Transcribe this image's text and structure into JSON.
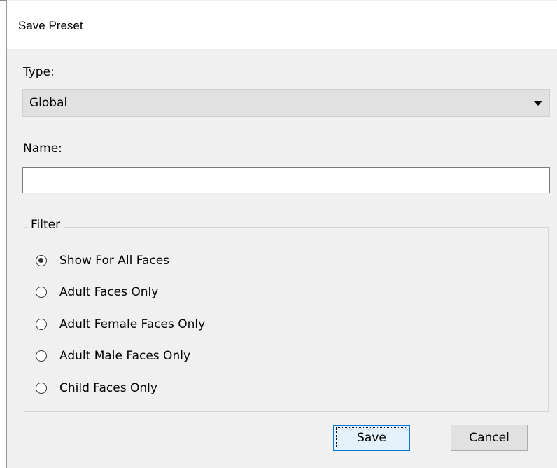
{
  "dialog": {
    "title": "Save Preset"
  },
  "type_field": {
    "label": "Type:",
    "selected": "Global"
  },
  "name_field": {
    "label": "Name:",
    "value": "",
    "placeholder": ""
  },
  "filter": {
    "title": "Filter",
    "options": [
      {
        "label": "Show For All Faces",
        "checked": true
      },
      {
        "label": "Adult Faces Only",
        "checked": false
      },
      {
        "label": "Adult Female Faces Only",
        "checked": false
      },
      {
        "label": "Adult Male Faces Only",
        "checked": false
      },
      {
        "label": "Child Faces Only",
        "checked": false
      }
    ]
  },
  "buttons": {
    "save": "Save",
    "cancel": "Cancel"
  },
  "colors": {
    "dialog_bg": "#f0f0f0",
    "titlebar_bg": "#ffffff",
    "default_button_border": "#0078d7"
  }
}
